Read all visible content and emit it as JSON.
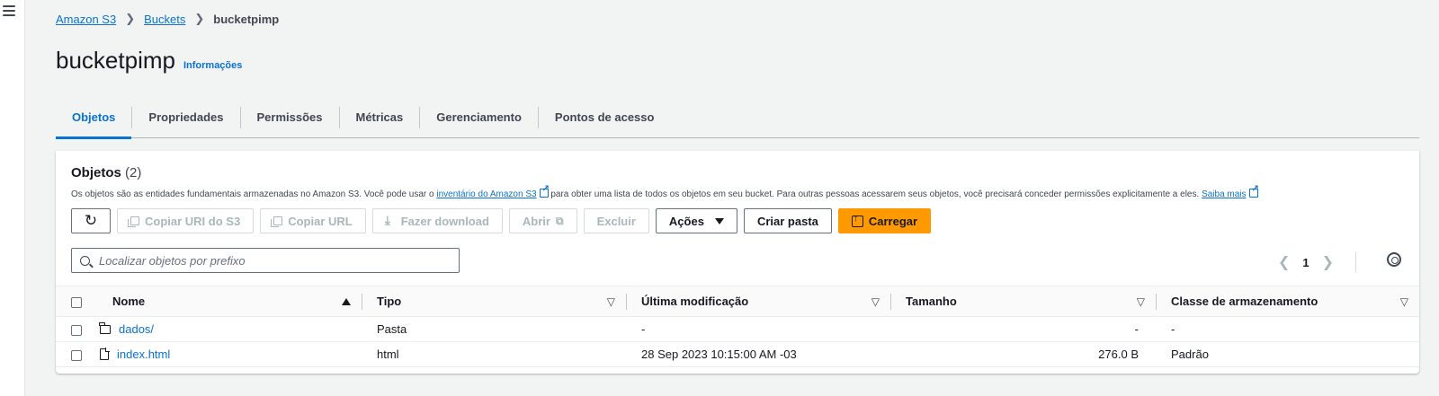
{
  "breadcrumb": {
    "items": [
      "Amazon S3",
      "Buckets"
    ],
    "current": "bucketpimp"
  },
  "page": {
    "title": "bucketpimp",
    "info_link": "Informações"
  },
  "tabs": [
    "Objetos",
    "Propriedades",
    "Permissões",
    "Métricas",
    "Gerenciamento",
    "Pontos de acesso"
  ],
  "panel": {
    "title": "Objetos",
    "count": "(2)",
    "desc_before": "Os objetos são as entidades fundamentais armazenadas no Amazon S3. Você pode usar o ",
    "desc_link": "inventário do Amazon S3",
    "desc_after": " para obter uma lista de todos os objetos em seu bucket. Para outras pessoas acessarem seus objetos, você precisará conceder permissões explicitamente a eles. ",
    "learn_more": "Saiba mais"
  },
  "toolbar": {
    "copy_uri": "Copiar URI do S3",
    "copy_url": "Copiar URL",
    "download": "Fazer download",
    "open": "Abrir",
    "delete": "Excluir",
    "actions": "Ações",
    "create_folder": "Criar pasta",
    "upload": "Carregar"
  },
  "search": {
    "placeholder": "Localizar objetos por prefixo"
  },
  "pagination": {
    "page": "1"
  },
  "table": {
    "headers": [
      "Nome",
      "Tipo",
      "Última modificação",
      "Tamanho",
      "Classe de armazenamento"
    ],
    "rows": [
      {
        "name": "dados/",
        "icon": "folder-icon",
        "type": "Pasta",
        "modified": "-",
        "size": "-",
        "storage_class": "-"
      },
      {
        "name": "index.html",
        "icon": "file-icon",
        "type": "html",
        "modified": "28 Sep 2023 10:15:00 AM -03",
        "size": "276.0 B",
        "storage_class": "Padrão"
      }
    ]
  },
  "colors": {
    "link": "#0972d3",
    "primary_button": "#ff9900",
    "background": "#f2f3f3"
  }
}
